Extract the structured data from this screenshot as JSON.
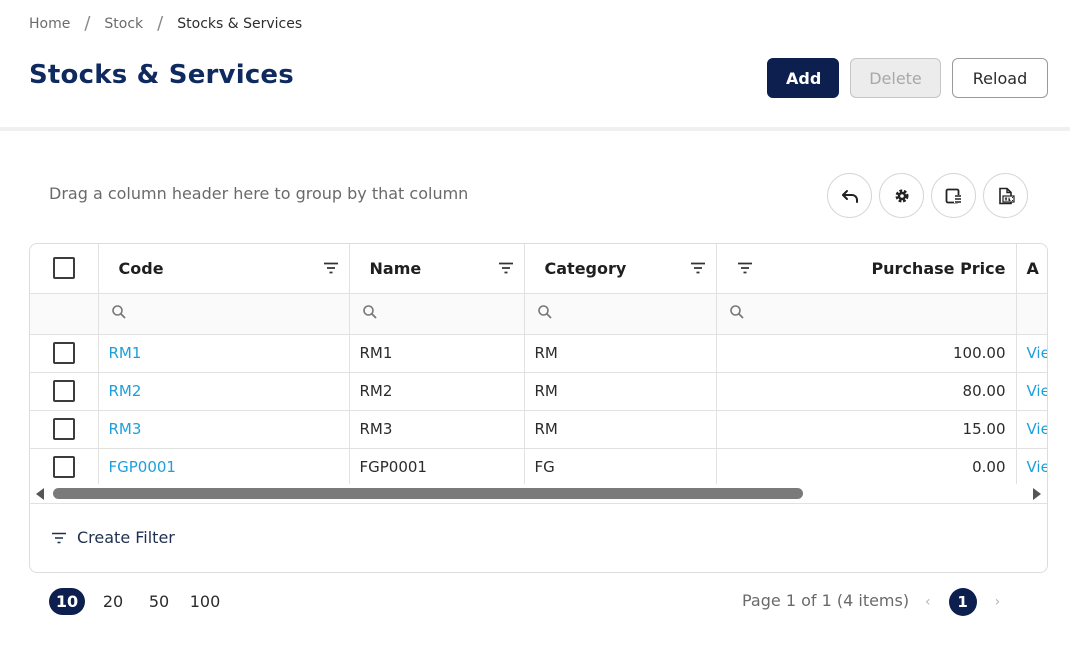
{
  "breadcrumb": {
    "items": [
      "Home",
      "Stock",
      "Stocks & Services"
    ],
    "separator": "/"
  },
  "page": {
    "title": "Stocks & Services"
  },
  "actions": {
    "add": "Add",
    "delete": "Delete",
    "reload": "Reload"
  },
  "grid": {
    "group_hint": "Drag a column header here to group by that column",
    "toolbar_icons": [
      "undo-icon",
      "gear-icon",
      "column-chooser-icon",
      "export-excel-icon"
    ],
    "columns": [
      "Code",
      "Name",
      "Category",
      "Purchase Price",
      "A"
    ],
    "rows": [
      {
        "code": "RM1",
        "name": "RM1",
        "category": "RM",
        "purchase_price": "100.00",
        "action": "View"
      },
      {
        "code": "RM2",
        "name": "RM2",
        "category": "RM",
        "purchase_price": "80.00",
        "action": "View"
      },
      {
        "code": "RM3",
        "name": "RM3",
        "category": "RM",
        "purchase_price": "15.00",
        "action": "View"
      },
      {
        "code": "FGP0001",
        "name": "FGP0001",
        "category": "FG",
        "purchase_price": "0.00",
        "action": "View"
      }
    ],
    "create_filter": "Create Filter"
  },
  "pager": {
    "sizes": [
      "10",
      "20",
      "50",
      "100"
    ],
    "selected_size": "10",
    "info": "Page 1 of 1 (4 items)",
    "prev": "‹",
    "current_page": "1",
    "next": "›"
  },
  "colors": {
    "primary": "#0c1f4f",
    "title": "#0f2a5f",
    "link": "#1e9fdc"
  }
}
